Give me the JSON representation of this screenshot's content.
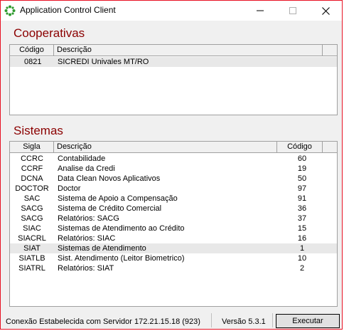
{
  "window": {
    "title": "Application Control Client"
  },
  "cooperativas": {
    "title": "Cooperativas",
    "columns": [
      "Código",
      "Descrição"
    ],
    "rows": [
      {
        "codigo": "0821",
        "descricao": "SICREDI Univales MT/RO"
      }
    ]
  },
  "sistemas": {
    "title": "Sistemas",
    "columns": [
      "Sigla",
      "Descrição",
      "Código"
    ],
    "rows": [
      {
        "sigla": "CCRC",
        "descricao": "Contabilidade",
        "codigo": "60"
      },
      {
        "sigla": "CCRF",
        "descricao": "Analise da Credi",
        "codigo": "19"
      },
      {
        "sigla": "DCNA",
        "descricao": "Data Clean Novos Aplicativos",
        "codigo": "50"
      },
      {
        "sigla": "DOCTOR",
        "descricao": "Doctor",
        "codigo": "97"
      },
      {
        "sigla": "SAC",
        "descricao": "Sistema de Apoio a Compensação",
        "codigo": "91"
      },
      {
        "sigla": "SACG",
        "descricao": "Sistema de Crédito Comercial",
        "codigo": "36"
      },
      {
        "sigla": "SACG",
        "descricao": "Relatórios: SACG",
        "codigo": "37"
      },
      {
        "sigla": "SIAC",
        "descricao": "Sistemas de Atendimento ao Crédito",
        "codigo": "15"
      },
      {
        "sigla": "SIACRL",
        "descricao": "Relatórios: SIAC",
        "codigo": "16"
      },
      {
        "sigla": "SIAT",
        "descricao": "Sistemas de Atendimento",
        "codigo": "1"
      },
      {
        "sigla": "SIATLB",
        "descricao": "Sist. Atendimento (Leitor Biometrico)",
        "codigo": "10"
      },
      {
        "sigla": "SIATRL",
        "descricao": "Relatórios: SIAT",
        "codigo": "2"
      }
    ],
    "selected_row": 9
  },
  "status": {
    "connection": "Conexão Estabelecida com Servidor 172.21.15.18 (923)",
    "version": "Versão 5.3.1",
    "execute_label": "Executar"
  },
  "icons": [
    "app-icon",
    "minimize-icon",
    "maximize-icon",
    "close-icon"
  ],
  "colors": {
    "section_title": "#8b0000",
    "window_border": "#e81123",
    "selected_row": "#e8e8e8"
  }
}
